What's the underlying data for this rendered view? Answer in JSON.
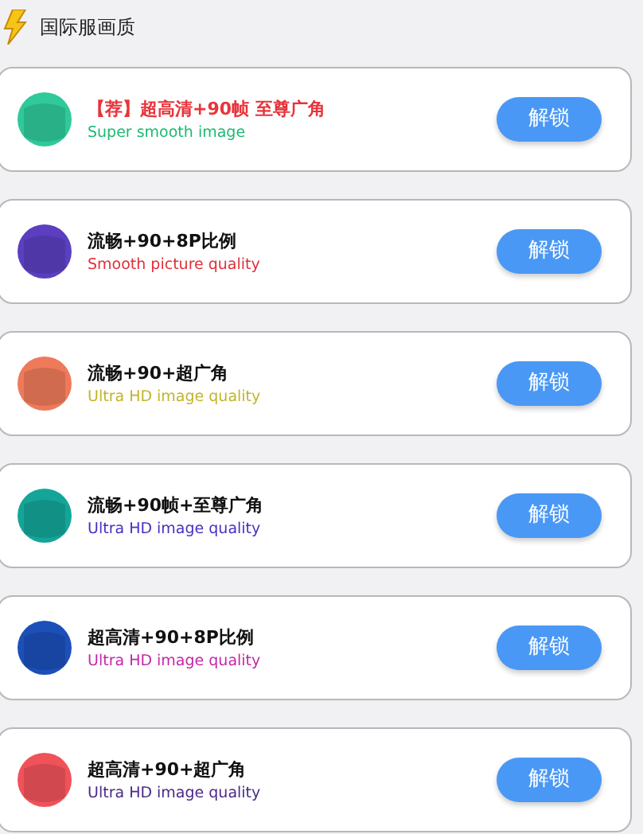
{
  "header": {
    "title": "国际服画质"
  },
  "options": [
    {
      "color": "#2fc99a",
      "title": {
        "text": "【荐】超高清+90帧 至尊广角",
        "color": "#e8343a"
      },
      "subtitle": {
        "text": "Super smooth image",
        "color": "#1fb873"
      },
      "button": "解锁"
    },
    {
      "color": "#5b3fc0",
      "title": {
        "text": "流畅+90+8P比例",
        "color": "#111111"
      },
      "subtitle": {
        "text": "Smooth picture quality",
        "color": "#e0303a"
      },
      "button": "解锁"
    },
    {
      "color": "#ee7a5a",
      "title": {
        "text": "流畅+90+超广角",
        "color": "#111111"
      },
      "subtitle": {
        "text": "Ultra HD image quality",
        "color": "#c2b42a"
      },
      "button": "解锁"
    },
    {
      "color": "#14a598",
      "title": {
        "text": "流畅+90帧+至尊广角",
        "color": "#111111"
      },
      "subtitle": {
        "text": "Ultra HD image quality",
        "color": "#4532c4"
      },
      "button": "解锁"
    },
    {
      "color": "#1c4fb8",
      "title": {
        "text": "超高清+90+8P比例",
        "color": "#111111"
      },
      "subtitle": {
        "text": "Ultra HD image quality",
        "color": "#c528a8"
      },
      "button": "解锁"
    },
    {
      "color": "#f0525a",
      "title": {
        "text": "超高清+90+超广角",
        "color": "#111111"
      },
      "subtitle": {
        "text": "Ultra HD image quality",
        "color": "#4a2a8a"
      },
      "button": "解锁"
    }
  ]
}
